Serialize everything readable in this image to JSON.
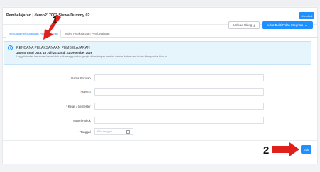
{
  "header": {
    "title": "Pembelajaran | demo217002 Siswa Dummy 02",
    "back_label": "Kembali"
  },
  "toolbar": {
    "upload_label": "Upload Ulang",
    "bukti_label": "Lihat Bukti Pakta Integritas"
  },
  "tabs": [
    {
      "label": "Rencana Pelaksanaan Pembelajaran",
      "active": true
    },
    {
      "label": "Video Pelaksanaan Pembelajaran",
      "active": false
    }
  ],
  "info": {
    "title": "RENCANA PELAKSANAAN PEMBELAJARAN",
    "dates": "Jadwal Entri Data: 16 Juli 2021 s.d. 31 Desember 2026",
    "note": "Unggah berkas berukuran besar lebih baik menggunakan google drive dengan permisi diakses bebas dan tautan disimpan ke isian ini"
  },
  "form": {
    "nama_sekolah_label": "Nama Sekolah",
    "npsn_label": "NPSN",
    "kelas_label": "Kelas / Semester",
    "materi_label": "Materi Pokok",
    "tanggal_label": "Tanggal",
    "tanggal_placeholder": "Pilih tanggal"
  },
  "footer": {
    "edit_label": "Edit"
  },
  "annotations": {
    "marker_1": "1",
    "marker_2": "2",
    "arrow_color": "#e0201b"
  },
  "colors": {
    "primary": "#1e90ff",
    "required": "#e53935",
    "info_bg": "#e6f4fc"
  }
}
